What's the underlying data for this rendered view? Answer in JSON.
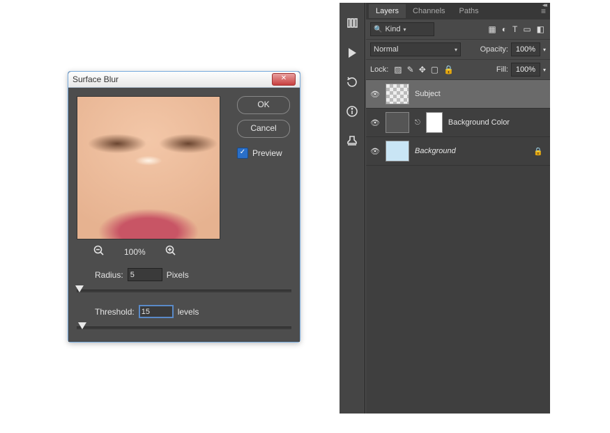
{
  "dialog": {
    "title": "Surface Blur",
    "ok": "OK",
    "cancel": "Cancel",
    "preview_label": "Preview",
    "preview_checked": true,
    "zoom": "100%",
    "radius_label": "Radius:",
    "radius_value": "5",
    "radius_unit": "Pixels",
    "threshold_label": "Threshold:",
    "threshold_value": "15",
    "threshold_unit": "levels"
  },
  "tools": [
    "brushes-icon",
    "play-icon",
    "rotate-icon",
    "info-icon",
    "stamp-icon"
  ],
  "panel": {
    "tabs": [
      "Layers",
      "Channels",
      "Paths"
    ],
    "active_tab": "Layers",
    "kind_label": "Kind",
    "blend_mode": "Normal",
    "opacity_label": "Opacity:",
    "opacity_value": "100%",
    "lock_label": "Lock:",
    "fill_label": "Fill:",
    "fill_value": "100%",
    "layers": [
      {
        "name": "Subject",
        "selected": true,
        "masked": false,
        "locked": false,
        "italic": false,
        "thumb": "subj"
      },
      {
        "name": "Background Color",
        "selected": false,
        "masked": true,
        "locked": false,
        "italic": false,
        "thumb": "bgclr"
      },
      {
        "name": "Background",
        "selected": false,
        "masked": false,
        "locked": true,
        "italic": true,
        "thumb": "bg"
      }
    ]
  }
}
